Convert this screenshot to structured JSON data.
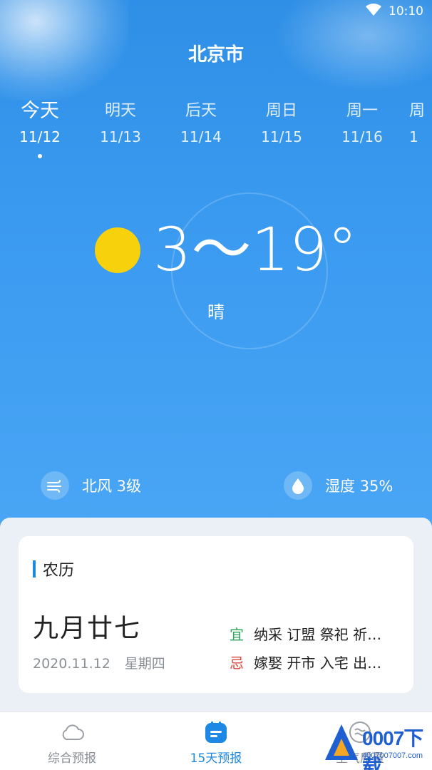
{
  "status_bar": {
    "time": "10:10",
    "wifi_icon": "wifi-icon"
  },
  "city": "北京市",
  "days": [
    {
      "name": "今天",
      "date": "11/12",
      "active": true
    },
    {
      "name": "明天",
      "date": "11/13"
    },
    {
      "name": "后天",
      "date": "11/14"
    },
    {
      "name": "周日",
      "date": "11/15"
    },
    {
      "name": "周一",
      "date": "11/16"
    },
    {
      "name": "周",
      "date": "1"
    }
  ],
  "today": {
    "temp_range": "3～19°",
    "condition": "晴",
    "weather_icon": "sun-icon",
    "wind": "北风 3级",
    "humidity": "湿度 35%"
  },
  "almanac": {
    "title": "农历",
    "lunar_date": "九月廿七",
    "solar_date": "2020.11.12",
    "weekday": "星期四",
    "yi_label": "宜",
    "yi_items": "纳采 订盟 祭祀 祈…",
    "ji_label": "忌",
    "ji_items": "嫁娶 开市 入宅 出…",
    "colors": {
      "yi": "#27a55a",
      "ji": "#e0483c",
      "accent": "#1e88e5"
    }
  },
  "tabs": [
    {
      "label": "综合预报",
      "icon": "cloud-icon"
    },
    {
      "label": "15天预报",
      "icon": "calendar-icon",
      "active": true
    },
    {
      "label": "空气质量",
      "icon": "air-quality-icon"
    }
  ],
  "watermark": {
    "text": "0007下载",
    "sub": "4007007007.com"
  }
}
